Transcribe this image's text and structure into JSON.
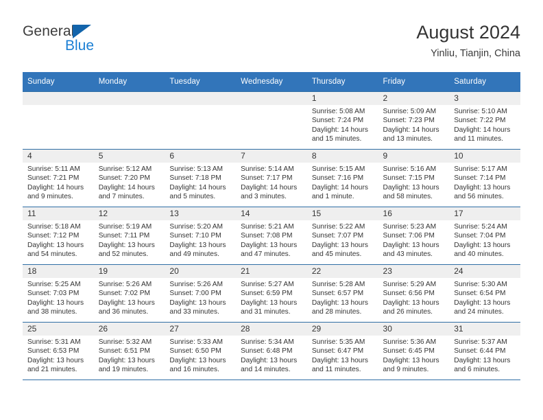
{
  "logo": {
    "word_one": "General",
    "word_two": "Blue",
    "triangle_color": "#1264ab",
    "blue_color": "#1b7fd4"
  },
  "header": {
    "title": "August 2024",
    "subtitle": "Yinliu, Tianjin, China"
  },
  "theme": {
    "header_bg": "#3275ba",
    "row_border": "#2e6da4",
    "daynum_band_bg": "#efefef",
    "text": "#333333"
  },
  "columns": [
    "Sunday",
    "Monday",
    "Tuesday",
    "Wednesday",
    "Thursday",
    "Friday",
    "Saturday"
  ],
  "weeks": [
    [
      {
        "day": "",
        "empty": true
      },
      {
        "day": "",
        "empty": true
      },
      {
        "day": "",
        "empty": true
      },
      {
        "day": "",
        "empty": true
      },
      {
        "day": "1",
        "sunrise": "Sunrise: 5:08 AM",
        "sunset": "Sunset: 7:24 PM",
        "daylight_line1": "Daylight: 14 hours",
        "daylight_line2": "and 15 minutes."
      },
      {
        "day": "2",
        "sunrise": "Sunrise: 5:09 AM",
        "sunset": "Sunset: 7:23 PM",
        "daylight_line1": "Daylight: 14 hours",
        "daylight_line2": "and 13 minutes."
      },
      {
        "day": "3",
        "sunrise": "Sunrise: 5:10 AM",
        "sunset": "Sunset: 7:22 PM",
        "daylight_line1": "Daylight: 14 hours",
        "daylight_line2": "and 11 minutes."
      }
    ],
    [
      {
        "day": "4",
        "sunrise": "Sunrise: 5:11 AM",
        "sunset": "Sunset: 7:21 PM",
        "daylight_line1": "Daylight: 14 hours",
        "daylight_line2": "and 9 minutes."
      },
      {
        "day": "5",
        "sunrise": "Sunrise: 5:12 AM",
        "sunset": "Sunset: 7:20 PM",
        "daylight_line1": "Daylight: 14 hours",
        "daylight_line2": "and 7 minutes."
      },
      {
        "day": "6",
        "sunrise": "Sunrise: 5:13 AM",
        "sunset": "Sunset: 7:18 PM",
        "daylight_line1": "Daylight: 14 hours",
        "daylight_line2": "and 5 minutes."
      },
      {
        "day": "7",
        "sunrise": "Sunrise: 5:14 AM",
        "sunset": "Sunset: 7:17 PM",
        "daylight_line1": "Daylight: 14 hours",
        "daylight_line2": "and 3 minutes."
      },
      {
        "day": "8",
        "sunrise": "Sunrise: 5:15 AM",
        "sunset": "Sunset: 7:16 PM",
        "daylight_line1": "Daylight: 14 hours",
        "daylight_line2": "and 1 minute."
      },
      {
        "day": "9",
        "sunrise": "Sunrise: 5:16 AM",
        "sunset": "Sunset: 7:15 PM",
        "daylight_line1": "Daylight: 13 hours",
        "daylight_line2": "and 58 minutes."
      },
      {
        "day": "10",
        "sunrise": "Sunrise: 5:17 AM",
        "sunset": "Sunset: 7:14 PM",
        "daylight_line1": "Daylight: 13 hours",
        "daylight_line2": "and 56 minutes."
      }
    ],
    [
      {
        "day": "11",
        "sunrise": "Sunrise: 5:18 AM",
        "sunset": "Sunset: 7:12 PM",
        "daylight_line1": "Daylight: 13 hours",
        "daylight_line2": "and 54 minutes."
      },
      {
        "day": "12",
        "sunrise": "Sunrise: 5:19 AM",
        "sunset": "Sunset: 7:11 PM",
        "daylight_line1": "Daylight: 13 hours",
        "daylight_line2": "and 52 minutes."
      },
      {
        "day": "13",
        "sunrise": "Sunrise: 5:20 AM",
        "sunset": "Sunset: 7:10 PM",
        "daylight_line1": "Daylight: 13 hours",
        "daylight_line2": "and 49 minutes."
      },
      {
        "day": "14",
        "sunrise": "Sunrise: 5:21 AM",
        "sunset": "Sunset: 7:08 PM",
        "daylight_line1": "Daylight: 13 hours",
        "daylight_line2": "and 47 minutes."
      },
      {
        "day": "15",
        "sunrise": "Sunrise: 5:22 AM",
        "sunset": "Sunset: 7:07 PM",
        "daylight_line1": "Daylight: 13 hours",
        "daylight_line2": "and 45 minutes."
      },
      {
        "day": "16",
        "sunrise": "Sunrise: 5:23 AM",
        "sunset": "Sunset: 7:06 PM",
        "daylight_line1": "Daylight: 13 hours",
        "daylight_line2": "and 43 minutes."
      },
      {
        "day": "17",
        "sunrise": "Sunrise: 5:24 AM",
        "sunset": "Sunset: 7:04 PM",
        "daylight_line1": "Daylight: 13 hours",
        "daylight_line2": "and 40 minutes."
      }
    ],
    [
      {
        "day": "18",
        "sunrise": "Sunrise: 5:25 AM",
        "sunset": "Sunset: 7:03 PM",
        "daylight_line1": "Daylight: 13 hours",
        "daylight_line2": "and 38 minutes."
      },
      {
        "day": "19",
        "sunrise": "Sunrise: 5:26 AM",
        "sunset": "Sunset: 7:02 PM",
        "daylight_line1": "Daylight: 13 hours",
        "daylight_line2": "and 36 minutes."
      },
      {
        "day": "20",
        "sunrise": "Sunrise: 5:26 AM",
        "sunset": "Sunset: 7:00 PM",
        "daylight_line1": "Daylight: 13 hours",
        "daylight_line2": "and 33 minutes."
      },
      {
        "day": "21",
        "sunrise": "Sunrise: 5:27 AM",
        "sunset": "Sunset: 6:59 PM",
        "daylight_line1": "Daylight: 13 hours",
        "daylight_line2": "and 31 minutes."
      },
      {
        "day": "22",
        "sunrise": "Sunrise: 5:28 AM",
        "sunset": "Sunset: 6:57 PM",
        "daylight_line1": "Daylight: 13 hours",
        "daylight_line2": "and 28 minutes."
      },
      {
        "day": "23",
        "sunrise": "Sunrise: 5:29 AM",
        "sunset": "Sunset: 6:56 PM",
        "daylight_line1": "Daylight: 13 hours",
        "daylight_line2": "and 26 minutes."
      },
      {
        "day": "24",
        "sunrise": "Sunrise: 5:30 AM",
        "sunset": "Sunset: 6:54 PM",
        "daylight_line1": "Daylight: 13 hours",
        "daylight_line2": "and 24 minutes."
      }
    ],
    [
      {
        "day": "25",
        "sunrise": "Sunrise: 5:31 AM",
        "sunset": "Sunset: 6:53 PM",
        "daylight_line1": "Daylight: 13 hours",
        "daylight_line2": "and 21 minutes."
      },
      {
        "day": "26",
        "sunrise": "Sunrise: 5:32 AM",
        "sunset": "Sunset: 6:51 PM",
        "daylight_line1": "Daylight: 13 hours",
        "daylight_line2": "and 19 minutes."
      },
      {
        "day": "27",
        "sunrise": "Sunrise: 5:33 AM",
        "sunset": "Sunset: 6:50 PM",
        "daylight_line1": "Daylight: 13 hours",
        "daylight_line2": "and 16 minutes."
      },
      {
        "day": "28",
        "sunrise": "Sunrise: 5:34 AM",
        "sunset": "Sunset: 6:48 PM",
        "daylight_line1": "Daylight: 13 hours",
        "daylight_line2": "and 14 minutes."
      },
      {
        "day": "29",
        "sunrise": "Sunrise: 5:35 AM",
        "sunset": "Sunset: 6:47 PM",
        "daylight_line1": "Daylight: 13 hours",
        "daylight_line2": "and 11 minutes."
      },
      {
        "day": "30",
        "sunrise": "Sunrise: 5:36 AM",
        "sunset": "Sunset: 6:45 PM",
        "daylight_line1": "Daylight: 13 hours",
        "daylight_line2": "and 9 minutes."
      },
      {
        "day": "31",
        "sunrise": "Sunrise: 5:37 AM",
        "sunset": "Sunset: 6:44 PM",
        "daylight_line1": "Daylight: 13 hours",
        "daylight_line2": "and 6 minutes."
      }
    ]
  ]
}
